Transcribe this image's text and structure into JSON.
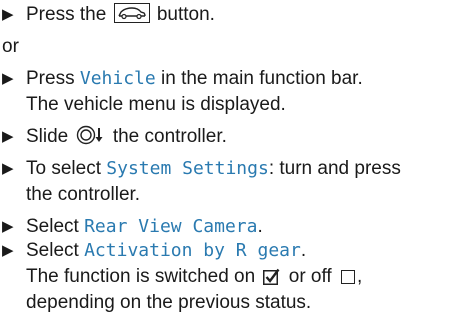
{
  "step1": {
    "pre": "Press the",
    "post": "button."
  },
  "or": "or",
  "step2": {
    "pre": "Press",
    "hl": "Vehicle",
    "post": "in the main function bar.",
    "line2": "The vehicle menu is displayed."
  },
  "step3": {
    "pre": "Slide",
    "post": "the controller."
  },
  "step4": {
    "pre": "To select",
    "hl": "System Settings",
    "post": ": turn and press",
    "line2": "the controller."
  },
  "step5": {
    "pre": "Select",
    "hl": "Rear View Camera",
    "post": "."
  },
  "step6": {
    "pre": "Select",
    "hl": "Activation by R gear",
    "post": ".",
    "line2_pre": "The function is switched on",
    "line2_mid": "or off",
    "line2_post": ",",
    "line3": "depending on the previous status."
  },
  "icons": {
    "bullet": "triangle-bullet-icon",
    "car_button": "car-button-icon",
    "controller": "controller-slide-down-icon",
    "checked": "checkbox-checked-icon",
    "unchecked": "checkbox-unchecked-icon"
  },
  "colors": {
    "highlight": "#2a7ab0",
    "text": "#1a1a1a"
  }
}
